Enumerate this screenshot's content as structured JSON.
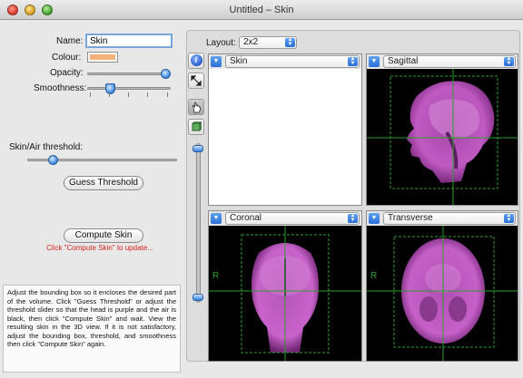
{
  "window": {
    "title": "Untitled – Skin"
  },
  "form": {
    "name_label": "Name:",
    "name_value": "Skin",
    "colour_label": "Colour:",
    "colour_value": "#f4b27a",
    "opacity_label": "Opacity:",
    "opacity_level": 1.0,
    "smoothness_label": "Smoothness:",
    "smoothness_level": 0.25,
    "threshold_label": "Skin/Air threshold:",
    "threshold_level": 0.15,
    "guess_button": "Guess Threshold",
    "compute_button": "Compute Skin",
    "compute_hint": "Click \"Compute Skin\" to update...",
    "help_text": "Adjust the bounding box so it encloses the desired part of the volume. Click \"Guess Threshold\" or adjust the threshold slider so that the head is purple and the air is black, then click \"Compute Skin\" and wait. View the resulting skin in the 3D view.  If it is not satisfactory, adjust the bounding box, threshold, and smoothness then click \"Compute Skin\" again."
  },
  "layout": {
    "label": "Layout:",
    "value": "2x2"
  },
  "toolbar": {
    "info_icon": "info-icon",
    "expand_icon": "expand-arrows-icon",
    "hand_icon": "hand-pointer-icon",
    "cube_icon": "cube-icon"
  },
  "views": [
    {
      "title": "Skin",
      "kind": "3d"
    },
    {
      "title": "Sagittal",
      "kind": "sagittal"
    },
    {
      "title": "Coronal",
      "kind": "coronal"
    },
    {
      "title": "Transverse",
      "kind": "transverse"
    }
  ],
  "view_side_label": "R",
  "colors": {
    "accent": "#2f7ce0",
    "overlay_line": "#2aa02a",
    "tissue": "#c653c6",
    "hint": "#d42020"
  }
}
